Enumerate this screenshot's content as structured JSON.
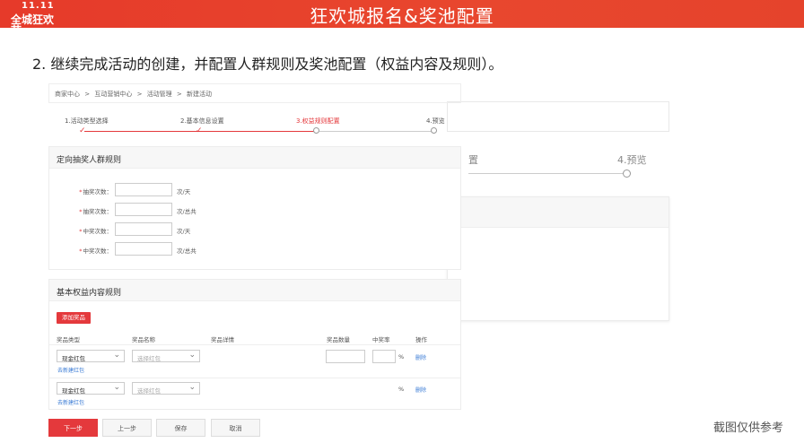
{
  "banner": {
    "logo_top": "11.11",
    "logo_bottom": "全城狂欢节",
    "title": "狂欢城报名&奖池配置"
  },
  "instruction": "2. 继续完成活动的创建，并配置人群规则及奖池配置（权益内容及规则）。",
  "ghost_panel": {
    "step_partial": "置",
    "step_last": "4.预览"
  },
  "breadcrumb": [
    "商家中心",
    ">",
    "互动营销中心",
    ">",
    "活动管理",
    ">",
    "新建活动"
  ],
  "steps": [
    {
      "label": "1.活动类型选择",
      "state": "done"
    },
    {
      "label": "2.基本信息设置",
      "state": "done"
    },
    {
      "label": "3.权益规则配置",
      "state": "active"
    },
    {
      "label": "4.预览",
      "state": "pending"
    }
  ],
  "crowd_section": {
    "title": "定向抽奖人群规则",
    "rows": [
      {
        "label": "抽奖次数：",
        "unit": "次/天"
      },
      {
        "label": "抽奖次数：",
        "unit": "次/总共"
      },
      {
        "label": "中奖次数：",
        "unit": "次/天"
      },
      {
        "label": "中奖次数：",
        "unit": "次/总共"
      }
    ]
  },
  "prize_section": {
    "title": "基本权益内容规则",
    "add_button": "添加奖品",
    "columns": [
      "奖品类型",
      "奖品名称",
      "奖品详情",
      "奖品数量",
      "中奖率",
      "操作"
    ],
    "rows": [
      {
        "type": "现金红包",
        "name_placeholder": "选择红包",
        "new_link": "去新建红包",
        "pct": "%",
        "action": "删除"
      },
      {
        "type": "现金红包",
        "name_placeholder": "选择红包",
        "new_link": "去新建红包",
        "pct": "%",
        "action": "删除"
      }
    ]
  },
  "footer": {
    "next": "下一步",
    "prev": "上一步",
    "save": "保存",
    "cancel": "取消"
  },
  "watermark": "截图仅供参考",
  "colors": {
    "accent": "#e4393c",
    "banner": "#e8472e",
    "link": "#3a7bd5"
  }
}
